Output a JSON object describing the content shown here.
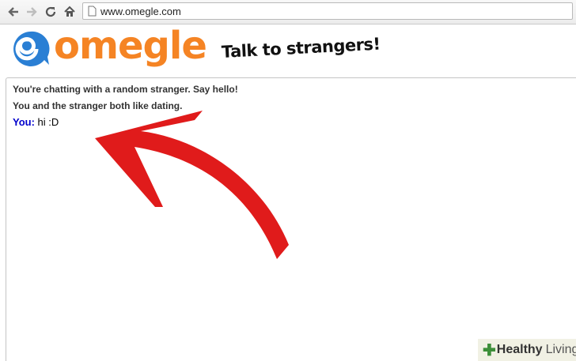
{
  "browser": {
    "url": "www.omegle.com",
    "icons": [
      "back-icon",
      "forward-icon",
      "reload-icon",
      "home-icon",
      "page-icon"
    ]
  },
  "header": {
    "logo_text": "omegle",
    "tagline": "Talk to strangers!"
  },
  "chat": {
    "status_lines": [
      "You're chatting with a random stranger. Say hello!",
      "You and the stranger both like dating."
    ],
    "messages": [
      {
        "sender": "You:",
        "text": "hi :D"
      }
    ]
  },
  "watermark": {
    "word1": "Healthy",
    "word2": "Living"
  },
  "colors": {
    "logo_orange": "#f58424",
    "logo_blue": "#2a7fd4",
    "sender_blue": "#0000cc",
    "arrow_red": "#e01b1b"
  }
}
